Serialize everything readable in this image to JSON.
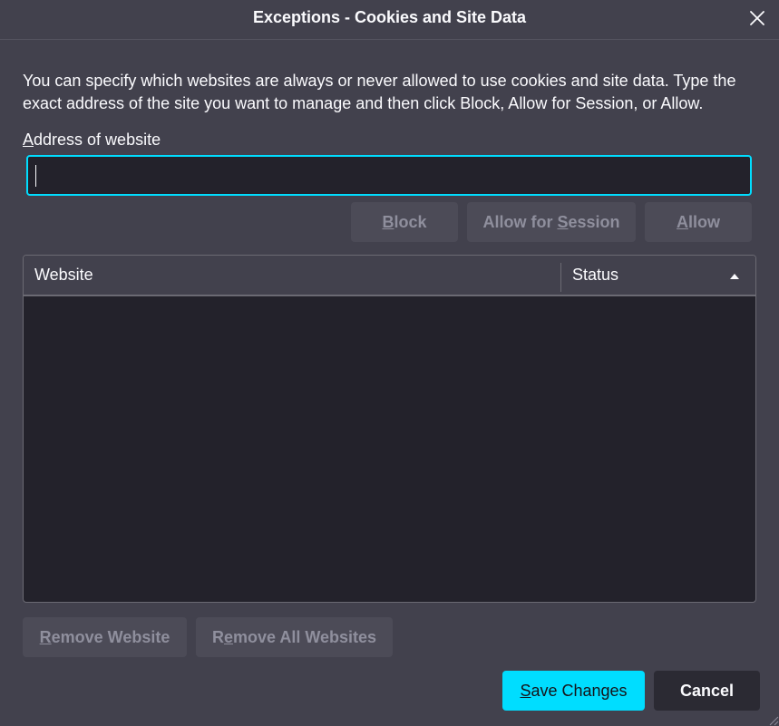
{
  "window": {
    "title": "Exceptions - Cookies and Site Data"
  },
  "description": "You can specify which websites are always or never allowed to use cookies and site data. Type the exact address of the site you want to manage and then click Block, Allow for Session, or Allow.",
  "address": {
    "label_key": "A",
    "label_rest": "ddress of website",
    "value": "",
    "placeholder": ""
  },
  "actions": {
    "block": {
      "pre": "",
      "key": "B",
      "post": "lock"
    },
    "allow_session": {
      "pre": "Allow for ",
      "key": "S",
      "post": "ession"
    },
    "allow": {
      "pre": "",
      "key": "A",
      "post": "llow"
    }
  },
  "table": {
    "columns": {
      "website": "Website",
      "status": "Status"
    },
    "sort_icon": "sort-ascending-icon",
    "rows": []
  },
  "footer": {
    "remove": {
      "pre": "",
      "key": "R",
      "post": "emove Website"
    },
    "remove_all": {
      "pre": "R",
      "key": "e",
      "post": "move All Websites"
    },
    "save": {
      "pre": "",
      "key": "S",
      "post": "ave Changes"
    },
    "cancel": "Cancel"
  },
  "colors": {
    "accent": "#00ddff",
    "background": "#42414d",
    "field": "#23222b"
  }
}
